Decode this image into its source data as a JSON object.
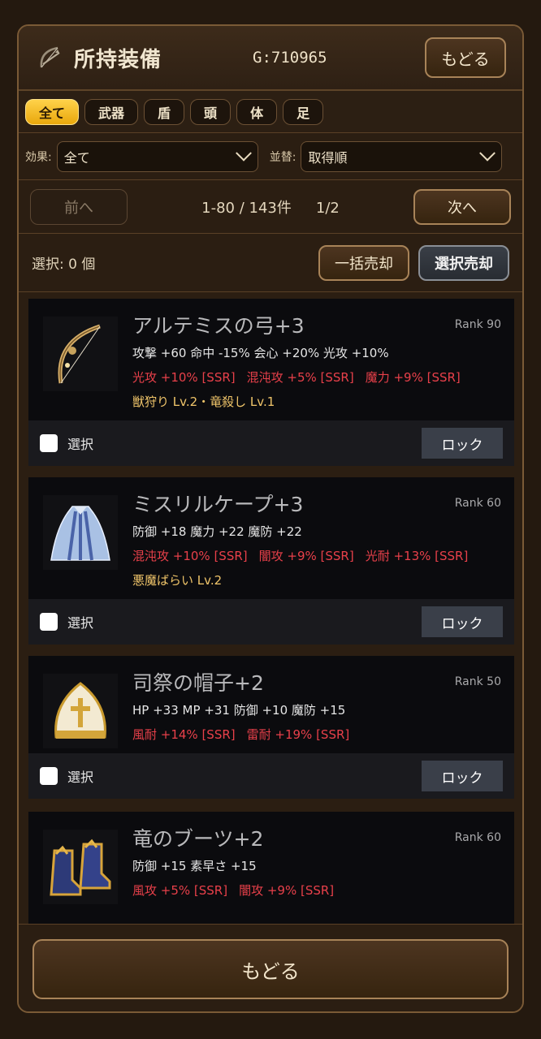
{
  "header": {
    "title": "所持装備",
    "gold": "G:710965",
    "back_label": "もどる"
  },
  "tabs": [
    {
      "label": "全て",
      "active": true
    },
    {
      "label": "武器",
      "active": false
    },
    {
      "label": "盾",
      "active": false
    },
    {
      "label": "頭",
      "active": false
    },
    {
      "label": "体",
      "active": false
    },
    {
      "label": "足",
      "active": false
    }
  ],
  "filters": {
    "effect_label": "効果:",
    "effect_value": "全て",
    "sort_label": "並替:",
    "sort_value": "取得順"
  },
  "pager": {
    "prev_label": "前へ",
    "range": "1-80 / 143件",
    "page": "1/2",
    "next_label": "次へ"
  },
  "selection": {
    "count_text": "選択: 0 個",
    "sell_all_label": "一括売却",
    "sell_selected_label": "選択売却"
  },
  "items": [
    {
      "name": "アルテミスの弓+3",
      "rank": "Rank 90",
      "stats": "攻撃 +60 命中 -15% 会心 +20% 光攻 +10%",
      "subs": [
        "光攻 +10% [SSR]",
        "混沌攻 +5% [SSR]",
        "魔力 +9% [SSR]"
      ],
      "skills": "獣狩り Lv.2・竜殺し Lv.1",
      "icon": "bow-icon",
      "select_label": "選択",
      "lock_label": "ロック"
    },
    {
      "name": "ミスリルケープ+3",
      "rank": "Rank 60",
      "stats": "防御 +18 魔力 +22 魔防 +22",
      "subs": [
        "混沌攻 +10% [SSR]",
        "闇攻 +9% [SSR]",
        "光耐 +13% [SSR]"
      ],
      "skills": "悪魔ばらい Lv.2",
      "icon": "cape-icon",
      "select_label": "選択",
      "lock_label": "ロック"
    },
    {
      "name": "司祭の帽子+2",
      "rank": "Rank 50",
      "stats": "HP +33 MP +31 防御 +10 魔防 +15",
      "subs": [
        "風耐 +14% [SSR]",
        "雷耐 +19% [SSR]"
      ],
      "skills": "",
      "icon": "mitre-hat-icon",
      "select_label": "選択",
      "lock_label": "ロック"
    },
    {
      "name": "竜のブーツ+2",
      "rank": "Rank 60",
      "stats": "防御 +15 素早さ +15",
      "subs": [
        "風攻 +5% [SSR]",
        "闇攻 +9% [SSR]"
      ],
      "skills": "",
      "icon": "boots-icon"
    }
  ],
  "footer": {
    "back_label": "もどる"
  },
  "colors": {
    "accent_gold": "#f2b824",
    "sub_red": "#e8404a",
    "skill_gold": "#f0c56a"
  }
}
